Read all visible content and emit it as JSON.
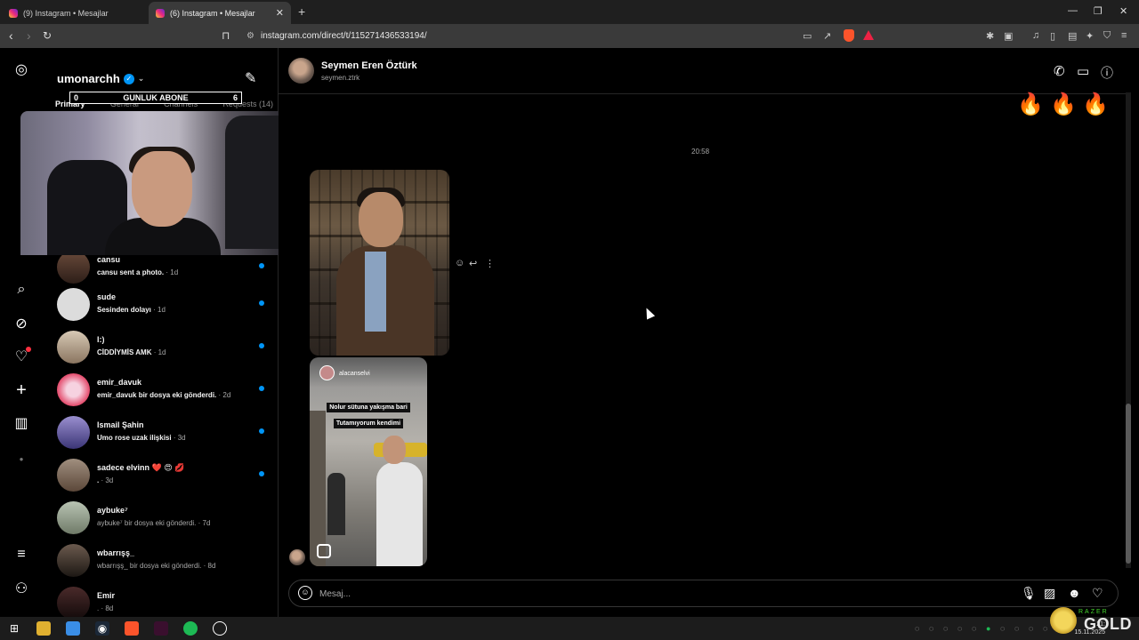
{
  "browser": {
    "tabs": [
      {
        "label": "(9) Instagram • Mesajlar"
      },
      {
        "label": "(6) Instagram • Mesajlar"
      }
    ],
    "url": "instagram.com/direct/t/115271436533194/"
  },
  "inbox": {
    "username": "umonarchh",
    "sub_counter": {
      "left": "0",
      "label": "GUNLUK ABONE",
      "right": "6"
    },
    "tabs": [
      "Primary",
      "General",
      "Channels",
      "Requests (14)"
    ],
    "conversations": [
      {
        "name": "cansu",
        "message": "cansu sent a photo.",
        "time": "· 1d",
        "unread": true
      },
      {
        "name": "sude",
        "message": "Sesinden dolayı",
        "time": "· 1d",
        "unread": true
      },
      {
        "name": "I:)",
        "message": "CİDDİYMİS AMK",
        "time": "· 1d",
        "unread": true
      },
      {
        "name": "emir_davuk",
        "message": "emir_davuk bir dosya eki gönderdi.",
        "time": "· 2d",
        "unread": true
      },
      {
        "name": "Ismail Şahin",
        "message": "Umo rose uzak ilişkisi",
        "time": "· 3d",
        "unread": true
      },
      {
        "name": "sadece elvinn ❤️ 😍 💋",
        "message": ".",
        "time": "· 3d",
        "unread": true
      },
      {
        "name": "aybuke⁷",
        "message": "aybuke⁷ bir dosya eki gönderdi.",
        "time": "· 7d",
        "unread": false
      },
      {
        "name": "wbarrışş_",
        "message": "wbarrışş_ bir dosya eki gönderdi.",
        "time": "· 8d",
        "unread": false
      },
      {
        "name": "Emir",
        "message": ".",
        "time": "· 8d",
        "unread": false
      }
    ]
  },
  "chat": {
    "name": "Seymen Eren Öztürk",
    "handle": "seymen.ztrk",
    "timestamp": "20:58",
    "story_user": "alacanselvi",
    "caption_line1": "Nolur sütuna yakışma bari",
    "caption_line2": "Tutamıyorum kendimi",
    "composer_placeholder": "Mesaj..."
  },
  "taskbar": {
    "clock_time": "21:",
    "clock_date": "15.11.2025",
    "brand_label": "RAZER",
    "badge_label": "GOLD"
  },
  "colors": {
    "accent_blue": "#0095f6",
    "notification_red": "#ff3040",
    "background": "#000000"
  }
}
